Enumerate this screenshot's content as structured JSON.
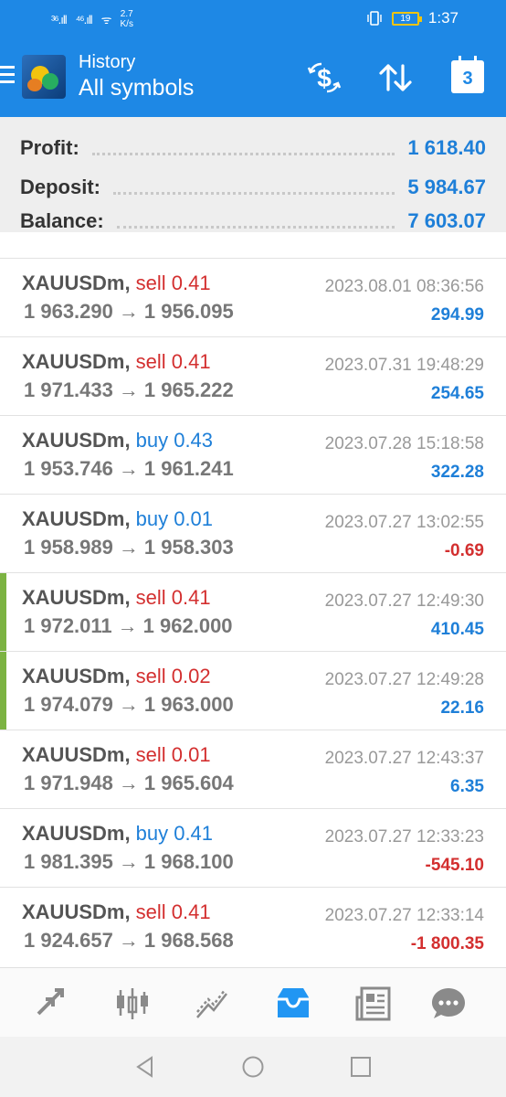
{
  "status_bar": {
    "signal_1": "³⁶.ıll",
    "signal_2": "⁴⁶.ıll",
    "wifi": "ᯤ",
    "speed_value": "2.7",
    "speed_unit": "K/s",
    "battery": "19",
    "time": "1:37"
  },
  "header": {
    "subtitle": "History",
    "title": "All symbols",
    "calendar_number": "3",
    "icons": [
      "currency-exchange-icon",
      "sort-icon",
      "calendar-icon"
    ]
  },
  "summary": {
    "profit_label": "Profit:",
    "profit_value": "1 618.40",
    "deposit_label": "Deposit:",
    "deposit_value": "5 984.67",
    "balance_label": "Balance:",
    "balance_value": "7 603.07"
  },
  "deals": [
    {
      "symbol": "XAUUSDm",
      "side": "sell",
      "volume": "0.41",
      "open": "1 963.290",
      "close": "1 956.095",
      "time": "2023.08.01 08:36:56",
      "profit": "294.99",
      "positive": true,
      "marked": false
    },
    {
      "symbol": "XAUUSDm",
      "side": "sell",
      "volume": "0.41",
      "open": "1 971.433",
      "close": "1 965.222",
      "time": "2023.07.31 19:48:29",
      "profit": "254.65",
      "positive": true,
      "marked": false
    },
    {
      "symbol": "XAUUSDm",
      "side": "buy",
      "volume": "0.43",
      "open": "1 953.746",
      "close": "1 961.241",
      "time": "2023.07.28 15:18:58",
      "profit": "322.28",
      "positive": true,
      "marked": false
    },
    {
      "symbol": "XAUUSDm",
      "side": "buy",
      "volume": "0.01",
      "open": "1 958.989",
      "close": "1 958.303",
      "time": "2023.07.27 13:02:55",
      "profit": "-0.69",
      "positive": false,
      "marked": false
    },
    {
      "symbol": "XAUUSDm",
      "side": "sell",
      "volume": "0.41",
      "open": "1 972.011",
      "close": "1 962.000",
      "time": "2023.07.27 12:49:30",
      "profit": "410.45",
      "positive": true,
      "marked": true
    },
    {
      "symbol": "XAUUSDm",
      "side": "sell",
      "volume": "0.02",
      "open": "1 974.079",
      "close": "1 963.000",
      "time": "2023.07.27 12:49:28",
      "profit": "22.16",
      "positive": true,
      "marked": true
    },
    {
      "symbol": "XAUUSDm",
      "side": "sell",
      "volume": "0.01",
      "open": "1 971.948",
      "close": "1 965.604",
      "time": "2023.07.27 12:43:37",
      "profit": "6.35",
      "positive": true,
      "marked": false
    },
    {
      "symbol": "XAUUSDm",
      "side": "buy",
      "volume": "0.41",
      "open": "1 981.395",
      "close": "1 968.100",
      "time": "2023.07.27 12:33:23",
      "profit": "-545.10",
      "positive": false,
      "marked": false
    },
    {
      "symbol": "XAUUSDm",
      "side": "sell",
      "volume": "0.41",
      "open": "1 924.657",
      "close": "1 968.568",
      "time": "2023.07.27 12:33:14",
      "profit": "-1 800.35",
      "positive": false,
      "marked": false
    }
  ],
  "bottom_nav": [
    {
      "name": "quotes",
      "icon": "quotes-arrows-icon",
      "active": false
    },
    {
      "name": "chart",
      "icon": "candlestick-chart-icon",
      "active": false
    },
    {
      "name": "trade",
      "icon": "trade-trend-icon",
      "active": false
    },
    {
      "name": "history",
      "icon": "history-inbox-icon",
      "active": true
    },
    {
      "name": "news",
      "icon": "news-icon",
      "active": false
    },
    {
      "name": "chat",
      "icon": "chat-bubble-icon",
      "active": false
    }
  ],
  "system_nav": {
    "back": "back-icon",
    "home": "home-icon",
    "recents": "recents-icon"
  },
  "colors": {
    "primary": "#1e88e5",
    "sell": "#d32f2f",
    "buy": "#1e7fd8",
    "positive_profit": "#1e7fd8",
    "negative_profit": "#d32f2f",
    "marker": "#7cb342"
  }
}
